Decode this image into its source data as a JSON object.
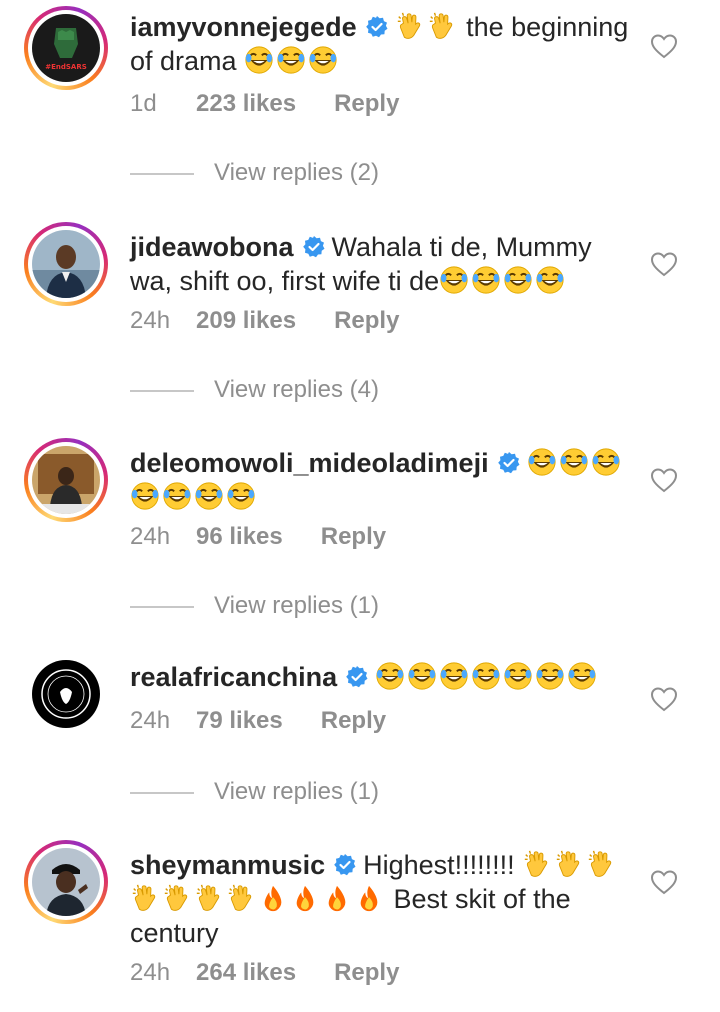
{
  "comments": [
    {
      "username": "iamyvonnejegede",
      "pre_emojis": [
        "clap-emoji",
        "clap-emoji"
      ],
      "text": "the beginning of drama",
      "post_emojis": [
        "laugh-emoji",
        "laugh-emoji",
        "laugh-emoji"
      ],
      "time": "1d",
      "likes": "223 likes",
      "reply": "Reply",
      "view_replies": "View replies (2)",
      "avatar_text": "#EndSARS",
      "ring": true
    },
    {
      "username": "jideawobona",
      "text": "Wahala ti de, Mummy wa, shift oo, first wife ti de",
      "post_emojis": [
        "laugh-emoji",
        "laugh-emoji",
        "laugh-emoji",
        "laugh-emoji"
      ],
      "time": "24h",
      "likes": "209 likes",
      "reply": "Reply",
      "view_replies": "View replies (4)",
      "ring": true
    },
    {
      "username": "deleomowoli_mideoladimeji",
      "post_emojis": [
        "laugh-emoji",
        "laugh-emoji",
        "laugh-emoji",
        "laugh-emoji",
        "laugh-emoji",
        "laugh-emoji",
        "laugh-emoji"
      ],
      "time": "24h",
      "likes": "96 likes",
      "reply": "Reply",
      "view_replies": "View replies (1)",
      "ring": true
    },
    {
      "username": "realafricanchina",
      "post_emojis": [
        "laugh-emoji",
        "laugh-emoji",
        "laugh-emoji",
        "laugh-emoji",
        "laugh-emoji",
        "laugh-emoji",
        "laugh-emoji"
      ],
      "time": "24h",
      "likes": "79 likes",
      "reply": "Reply",
      "view_replies": "View replies (1)",
      "ring": false
    },
    {
      "username": "sheymanmusic",
      "text": "Highest!!!!!!!!",
      "post_emojis": [
        "clap-emoji",
        "clap-emoji",
        "clap-emoji",
        "clap-emoji",
        "clap-emoji",
        "clap-emoji",
        "clap-emoji",
        "fire-emoji",
        "fire-emoji",
        "fire-emoji",
        "fire-emoji"
      ],
      "text2": "Best skit of the century",
      "time": "24h",
      "likes": "264 likes",
      "reply": "Reply",
      "ring": true
    }
  ],
  "colors": {
    "text": "#262626",
    "secondary": "#8e8e8e",
    "verified": "#3897f0",
    "ring_gradient": [
      "#feda75",
      "#fa7e1e",
      "#d62976",
      "#962fbf"
    ]
  },
  "icons": {
    "verified": "verified-badge-icon",
    "like": "heart-outline-icon"
  }
}
